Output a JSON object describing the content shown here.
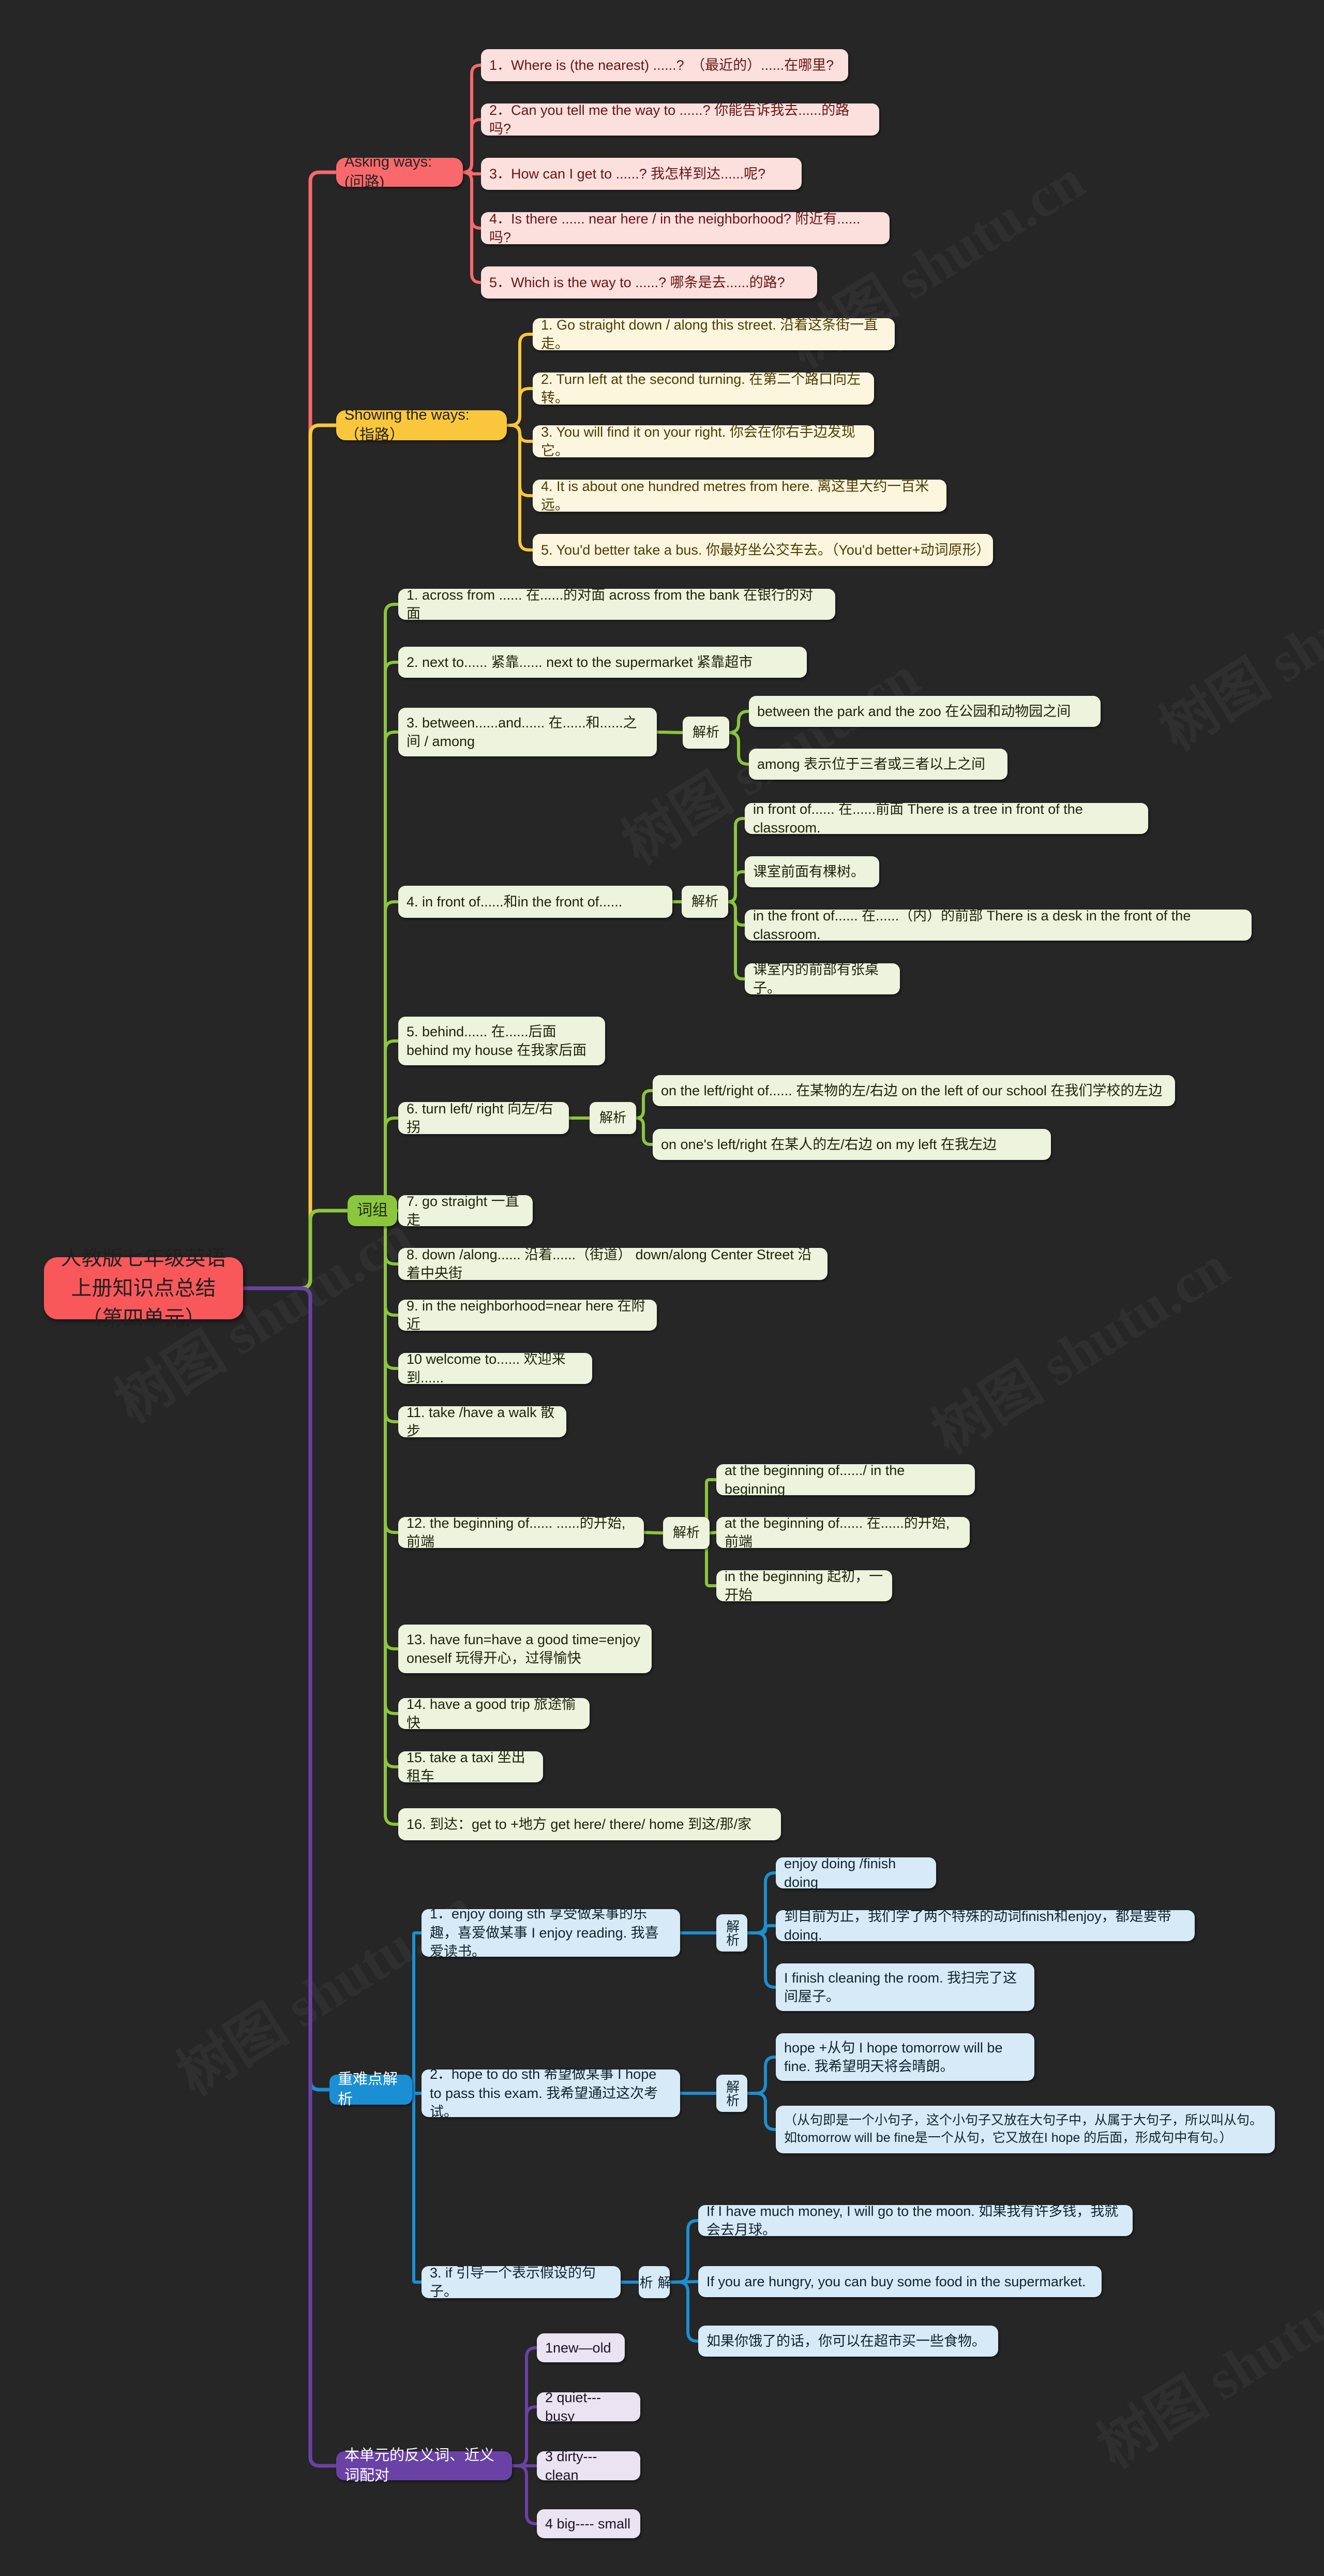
{
  "root": {
    "title": "人教版七年级英语上册知识点总结（第四单元）"
  },
  "colors": {
    "background": "#262626",
    "root": "#F9585B",
    "branch_red": "#F9696B",
    "branch_yellow": "#FAC73C",
    "branch_green": "#8CC63E",
    "branch_blue": "#1B8FD4",
    "branch_purple": "#6A42A5",
    "card_red": "#FBE0DE",
    "card_yellow": "#FDF6DF",
    "card_green": "#EDF3DC",
    "card_blue": "#D6EAF7",
    "card_purple": "#EAE3F2"
  },
  "watermark": "树图 shutu.cn",
  "branches": {
    "asking": {
      "label": "Asking ways: (问路)",
      "items": [
        "1．Where is (the nearest) ......?　（最近的）......在哪里?",
        "2．Can you tell me the way to ......?  你能告诉我去......的路吗?",
        "3．How can I get to ......?  我怎样到达......呢?",
        "4．Is there ...... near here / in the neighborhood? 附近有......吗?",
        "5．Which is the way to ......?  哪条是去......的路?"
      ]
    },
    "showing": {
      "label": "Showing the ways:（指路）",
      "items": [
        "1. Go straight down / along this street. 沿着这条街一直走。",
        "2. Turn left at the second turning. 在第二个路口向左转。",
        "3. You will find it on your right. 你会在你右手边发现它。",
        "4. It is about one hundred metres from here. 离这里大约一百米远。",
        "5. You'd better take a bus. 你最好坐公交车去。（You'd better+动词原形）"
      ]
    },
    "phrases": {
      "label": "词组",
      "analysis_label": "解析",
      "items": [
        {
          "text": "1. across from ...... 在......的对面 across from the bank 在银行的对面",
          "subs": []
        },
        {
          "text": "2. next to...... 紧靠...... next to the supermarket 紧靠超市",
          "subs": []
        },
        {
          "text": "3. between......and...... 在......和......之间 / among",
          "subs": [
            "between the park and the zoo 在公园和动物园之间",
            "among 表示位于三者或三者以上之间"
          ]
        },
        {
          "text": "4. in front of......和in the front of......",
          "subs": [
            "in front of...... 在......前面 There is a tree in front of the classroom.",
            "课室前面有棵树。",
            "in the front of...... 在......（内）的前部 There is a desk in the front of the classroom.",
            "课室内的前部有张桌子。"
          ]
        },
        {
          "text": "5. behind...... 在......后面 behind my house 在我家后面",
          "subs": []
        },
        {
          "text": "6. turn left/ right 向左/右拐",
          "subs": [
            "on the left/right of...... 在某物的左/右边 on the left of our school 在我们学校的左边",
            "on one's left/right 在某人的左/右边 on my left 在我左边"
          ]
        },
        {
          "text": "7. go straight 一直走",
          "subs": []
        },
        {
          "text": "8. down /along...... 沿着......（街道）  down/along Center Street 沿着中央街",
          "subs": []
        },
        {
          "text": "9. in the neighborhood=near here 在附近",
          "subs": []
        },
        {
          "text": "10 welcome to...... 欢迎来到......",
          "subs": []
        },
        {
          "text": "11. take /have a walk 散步",
          "subs": []
        },
        {
          "text": "12. the beginning of...... ......的开始,前端",
          "subs": [
            "at the beginning of....../ in the beginning",
            "at the beginning of...... 在......的开始,前端",
            "in the beginning 起初，一开始"
          ]
        },
        {
          "text": "13. have fun=have a good time=enjoy oneself 玩得开心，过得愉快",
          "subs": []
        },
        {
          "text": "14. have a good trip 旅途愉快",
          "subs": []
        },
        {
          "text": "15. take a taxi 坐出租车",
          "subs": []
        },
        {
          "text": "16. 到达：get to +地方 get here/ there/ home 到这/那/家",
          "subs": []
        }
      ]
    },
    "keypoints": {
      "label": "重难点解析",
      "analysis_label": "解析",
      "items": [
        {
          "text": "1．enjoy doing sth 享受做某事的乐趣，喜爱做某事 I enjoy reading. 我喜爱读书。",
          "subs": [
            "enjoy doing /finish doing",
            "到目前为止，我们学了两个特殊的动词finish和enjoy，都是要带 doing.",
            "I finish cleaning the room. 我扫完了这间屋子。"
          ]
        },
        {
          "text": "2．hope to do sth 希望做某事 I hope to pass this exam. 我希望通过这次考试。",
          "subs": [
            "hope +从句 I hope tomorrow will be fine. 我希望明天将会晴朗。",
            "（从句即是一个小句子，这个小句子又放在大句子中，从属于大句子，所以叫从句。如tomorrow will be fine是一个从句，它又放在I hope 的后面，形成句中有句。）"
          ]
        },
        {
          "text": "3. if 引导一个表示假设的句子。",
          "subs": [
            "If I have much money, I will go to the moon. 如果我有许多钱，我就会去月球。",
            "If you are hungry, you can buy some food in the supermarket.",
            "如果你饿了的话，你可以在超市买一些食物。"
          ]
        }
      ]
    },
    "antonyms": {
      "label": "本单元的反义词、近义词配对",
      "items": [
        "1new—old",
        "2 quiet--- busy",
        "3 dirty--- clean",
        "4 big---- small"
      ]
    }
  }
}
